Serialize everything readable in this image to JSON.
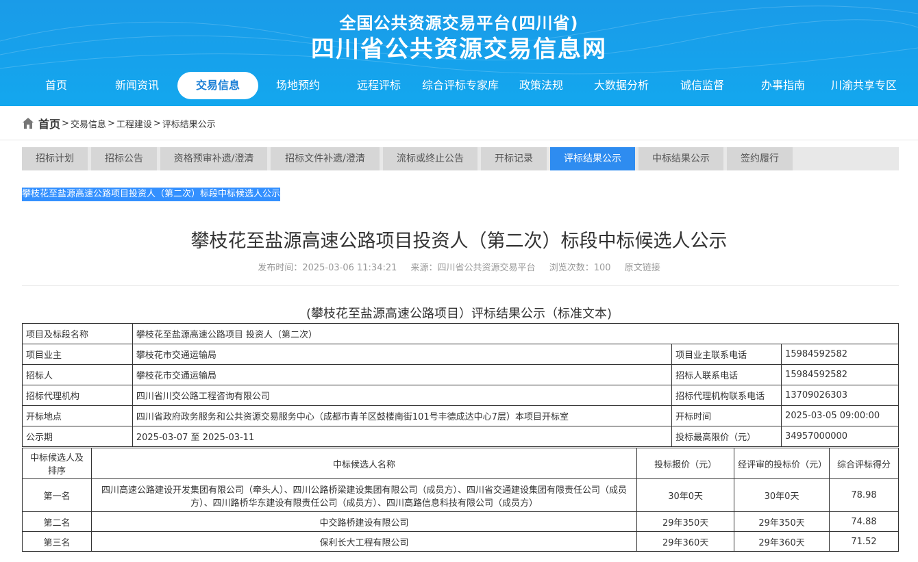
{
  "header": {
    "title_small": "全国公共资源交易平台(四川省)",
    "title_large": "四川省公共资源交易信息网"
  },
  "nav": [
    {
      "label": "首页",
      "active": false
    },
    {
      "label": "新闻资讯",
      "active": false
    },
    {
      "label": "交易信息",
      "active": true
    },
    {
      "label": "场地预约",
      "active": false
    },
    {
      "label": "远程评标",
      "active": false
    },
    {
      "label": "综合评标专家库",
      "active": false
    },
    {
      "label": "政策法规",
      "active": false
    },
    {
      "label": "大数据分析",
      "active": false
    },
    {
      "label": "诚信监督",
      "active": false
    },
    {
      "label": "办事指南",
      "active": false
    },
    {
      "label": "川渝共享专区",
      "active": false
    }
  ],
  "breadcrumb": {
    "home": "首页",
    "items": [
      "交易信息",
      "工程建设",
      "评标结果公示"
    ]
  },
  "tabs": [
    {
      "label": "招标计划",
      "active": false
    },
    {
      "label": "招标公告",
      "active": false
    },
    {
      "label": "资格预审补遗/澄清",
      "active": false
    },
    {
      "label": "招标文件补遗/澄清",
      "active": false
    },
    {
      "label": "流标或终止公告",
      "active": false
    },
    {
      "label": "开标记录",
      "active": false
    },
    {
      "label": "评标结果公示",
      "active": true
    },
    {
      "label": "中标结果公示",
      "active": false
    },
    {
      "label": "签约履行",
      "active": false
    }
  ],
  "selected_title": "攀枝花至盐源高速公路项目投资人（第二次）标段中标候选人公示",
  "article": {
    "title": "攀枝花至盐源高速公路项目投资人（第二次）标段中标候选人公示",
    "publish_label": "发布时间：",
    "publish_time": "2025-03-06 11:34:21",
    "source_label": "来源：",
    "source": "四川省公共资源交易平台",
    "views_label": "浏览次数：",
    "views": "100",
    "original_link": "原文链接"
  },
  "table_caption": "(攀枝花至盐源高速公路项目）评标结果公示（标准文本)",
  "info": {
    "project_name_label": "项目及标段名称",
    "project_name": "攀枝花至盐源高速公路项目 投资人（第二次）",
    "owner_label": "项目业主",
    "owner": "攀枝花市交通运输局",
    "owner_phone_label": "项目业主联系电话",
    "owner_phone": "15984592582",
    "tenderer_label": "招标人",
    "tenderer": "攀枝花市交通运输局",
    "tenderer_phone_label": "招标人联系电话",
    "tenderer_phone": "15984592582",
    "agency_label": "招标代理机构",
    "agency": "四川省川交公路工程咨询有限公司",
    "agency_phone_label": "招标代理机构联系电话",
    "agency_phone": "13709026303",
    "location_label": "开标地点",
    "location": "四川省政府政务服务和公共资源交易服务中心（成都市青羊区鼓楼南街101号丰德成达中心7层）本项目开标室",
    "open_time_label": "开标时间",
    "open_time": "2025-03-05 09:00:00",
    "period_label": "公示期",
    "period": "2025-03-07 至 2025-03-11",
    "max_price_label": "投标最高限价（元）",
    "max_price": "34957000000"
  },
  "candidates": {
    "headers": [
      "中标候选人及排序",
      "中标候选人名称",
      "投标报价（元）",
      "经评审的投标价（元）",
      "综合评标得分"
    ],
    "rows": [
      {
        "rank": "第一名",
        "name": "四川高速公路建设开发集团有限公司（牵头人）、四川公路桥梁建设集团有限公司（成员方）、四川省交通建设集团有限责任公司（成员方）、四川路桥华东建设有限责任公司（成员方）、四川高路信息科技有限公司（成员方）",
        "bid": "30年0天",
        "evaluated": "30年0天",
        "score": "78.98"
      },
      {
        "rank": "第二名",
        "name": "中交路桥建设有限公司",
        "bid": "29年350天",
        "evaluated": "29年350天",
        "score": "74.88"
      },
      {
        "rank": "第三名",
        "name": "保利长大工程有限公司",
        "bid": "29年360天",
        "evaluated": "29年360天",
        "score": "71.52"
      }
    ]
  }
}
